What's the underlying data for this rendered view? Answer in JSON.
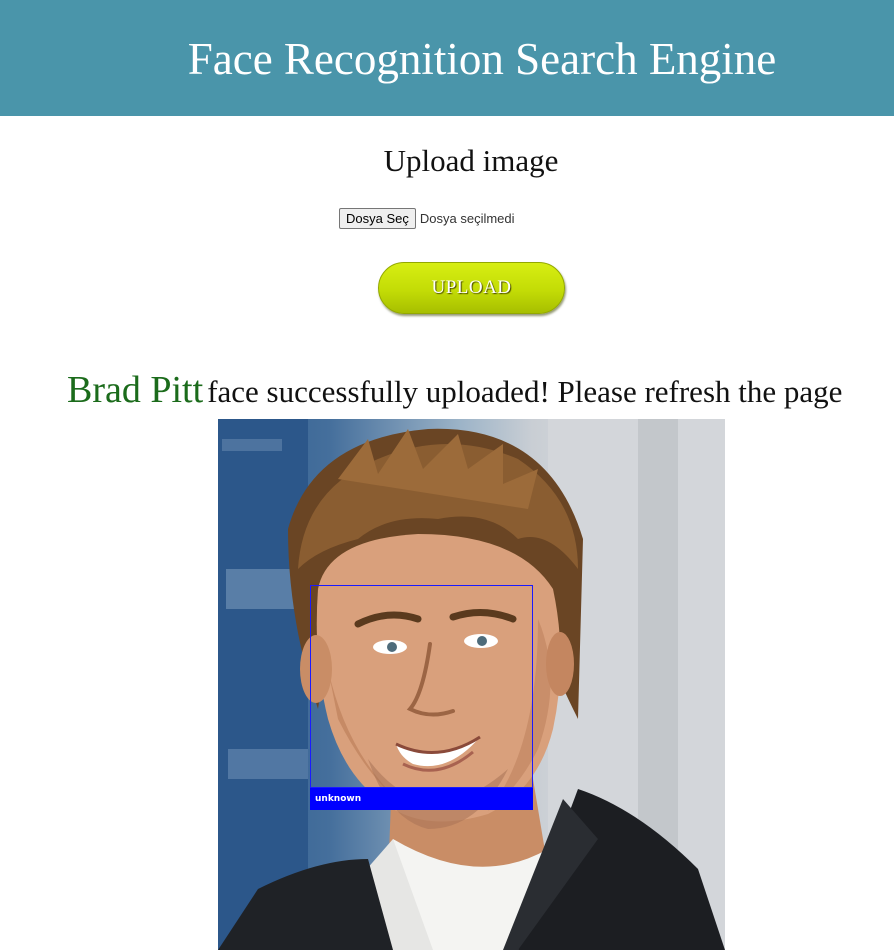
{
  "header": {
    "title": "Face Recognition Search Engine",
    "background": "#4a95aa"
  },
  "upload": {
    "heading": "Upload image",
    "file_button_label": "Dosya Seç",
    "file_status": "Dosya seçilmedi",
    "submit_label": "UPLOAD",
    "submit_color": "#c3dc06"
  },
  "result": {
    "person_name": "Brad Pitt",
    "message": "face successfully uploaded! Please refresh the page",
    "name_color": "#1b6b1b"
  },
  "photo": {
    "detection_label": "unknown",
    "box_color": "#0000ff"
  }
}
